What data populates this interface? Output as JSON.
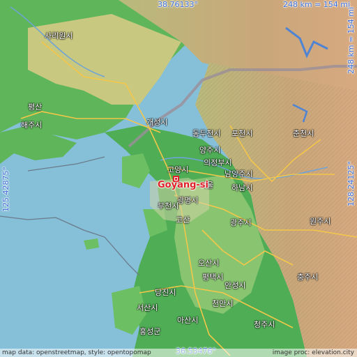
{
  "map": {
    "focus_place": "Goyang-si",
    "coords": {
      "top": "38.76133°",
      "bottom": "36.53476°",
      "left": "125.42875°",
      "right": "128.24125°"
    },
    "scale": {
      "top": "248 km = 154 mi",
      "right": "248 km = 154 mi"
    },
    "attribution_left": "map data: openstreetmap, style: opentopomap",
    "attribution_right": "image proc: elevation.city",
    "places": [
      "사리원시",
      "해주시",
      "개성시",
      "동두천시",
      "포천시",
      "춘천시",
      "양주시",
      "의정부시",
      "고양시",
      "남양주시",
      "하남시",
      "서울",
      "광명시",
      "부천시",
      "광주시",
      "원주시",
      "오산시",
      "평택시",
      "안성시",
      "충주시",
      "당진시",
      "천안시",
      "서산시",
      "아산시",
      "청주시",
      "홍성군",
      "평산",
      "고산"
    ]
  }
}
